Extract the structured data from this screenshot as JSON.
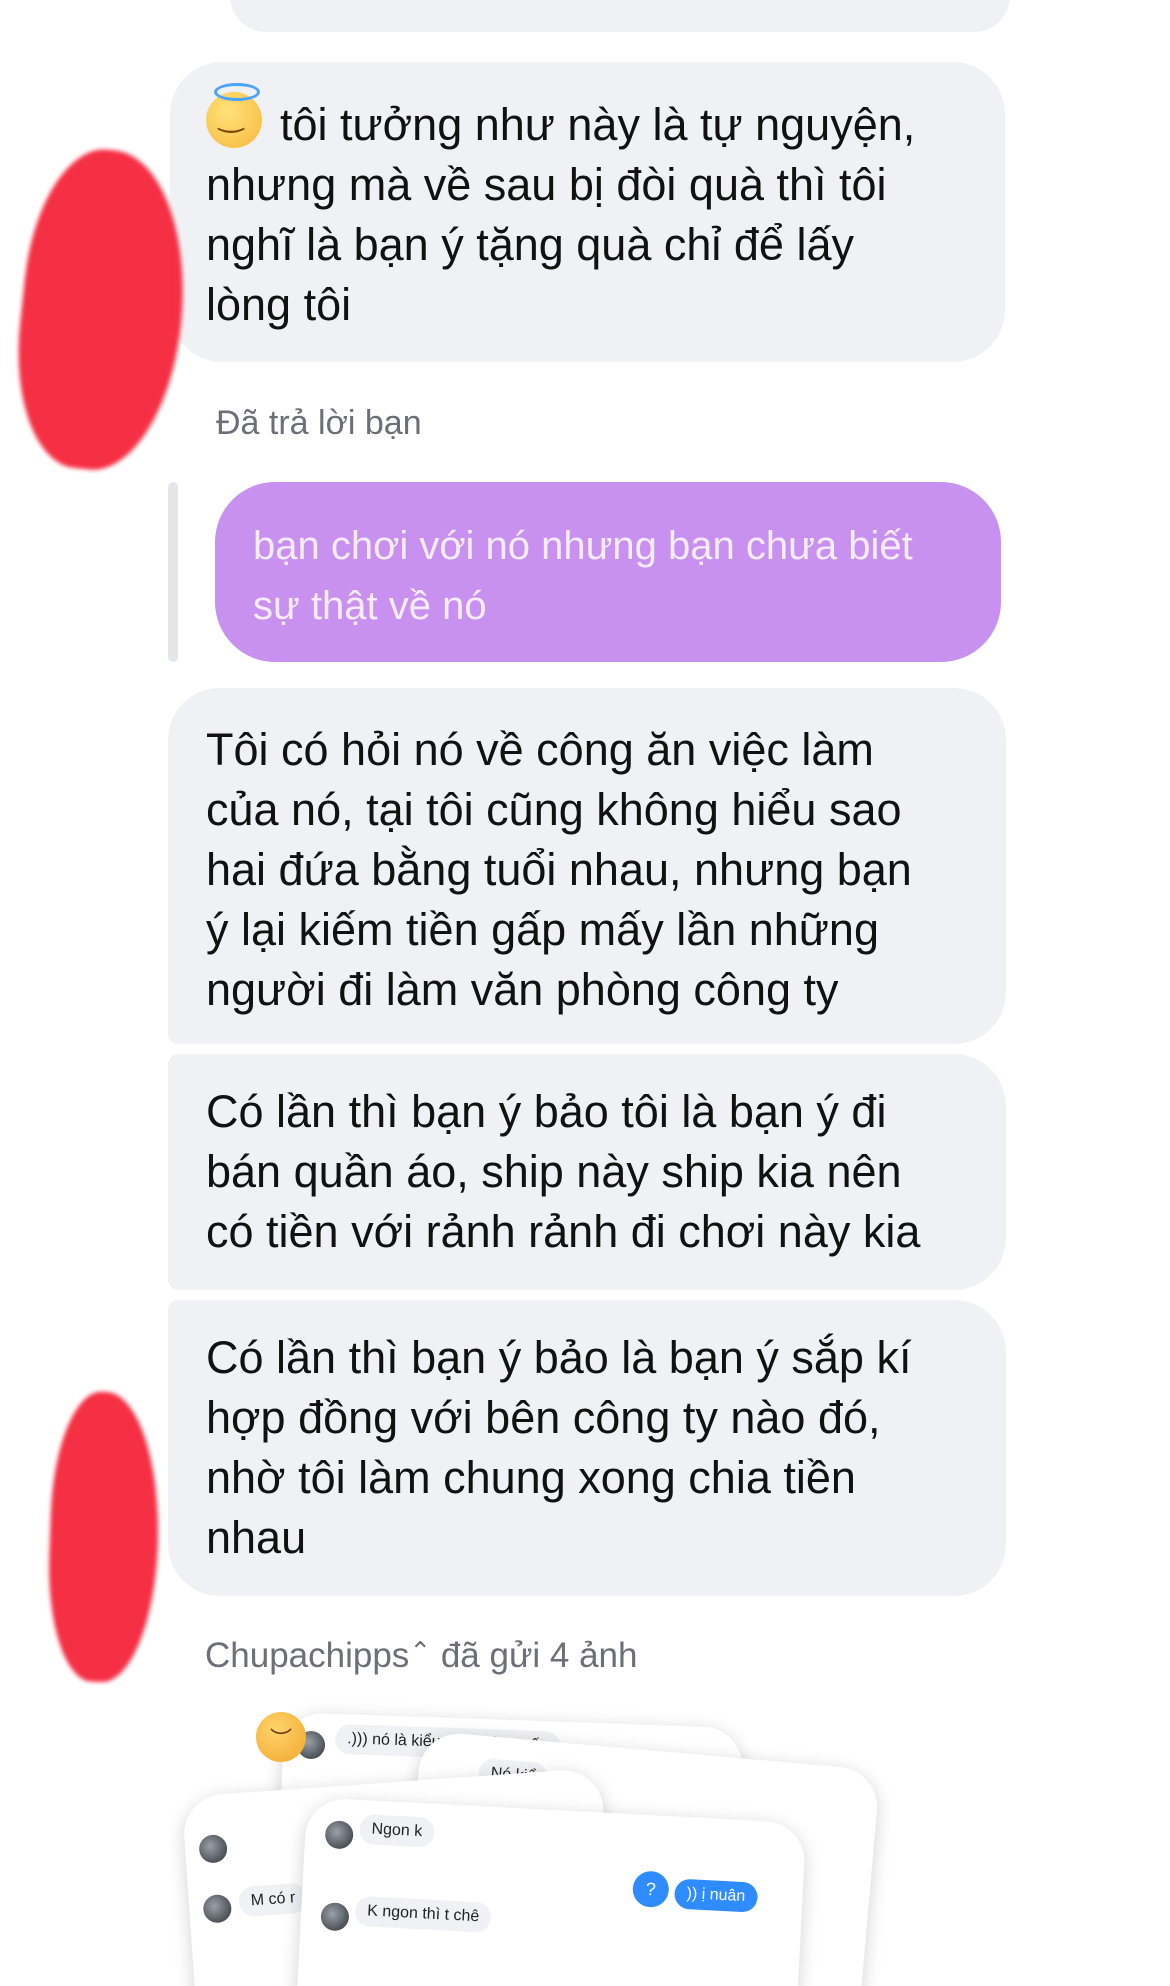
{
  "messages": {
    "m1": {
      "emoji_icon": "smiling-face-with-halo",
      "lines": [
        "tôi tưởng như này là tự nguyện,",
        "nhưng mà về sau bị đòi quà thì tôi",
        "nghĩ là bạn ý tặng quà chỉ để lấy",
        "lòng tôi"
      ]
    },
    "reply": {
      "label": "Đã trả lời bạn",
      "lines": [
        "bạn chơi với nó nhưng bạn chưa biết",
        "sự thật về nó"
      ],
      "bubble_color": "#c891ef"
    },
    "m2": {
      "lines": [
        "Tôi có hỏi nó về công ăn việc làm",
        "của nó, tại tôi cũng không hiểu sao",
        "hai đứa bằng tuổi nhau, nhưng bạn",
        "ý lại kiếm tiền gấp mấy lần những",
        "người đi làm văn phòng công ty"
      ]
    },
    "m3": {
      "lines": [
        "Có lần thì bạn ý bảo tôi là bạn ý đi",
        "bán quần áo, ship này ship kia nên",
        "có tiền với rảnh rảnh đi chơi này kia"
      ]
    },
    "m4": {
      "lines": [
        "Có lần thì bạn ý bảo là bạn ý sắp kí",
        "hợp đồng với bên công ty nào đó,",
        "nhờ tôi làm chung xong chia tiền",
        "nhau"
      ]
    }
  },
  "sent_photos": {
    "sender": "Chupachipps",
    "sender_badge_icon": "sparkle-icon",
    "text": "đã gửi 4 ảnh",
    "cards": {
      "c1_chip": ".))) nó là kiểu xoay vòng vốn",
      "c1_blue": ")))))",
      "c2_chip": "Nó kiể",
      "c3_chip": "M có r",
      "c4_chip1": "Ngon k",
      "c4_chip2": "K ngon thì t chê",
      "c4_blue": ")) ị nuân",
      "c4_dot": "?"
    }
  },
  "colors": {
    "incoming_bubble": "#eff1f4",
    "muted_text": "#6b6f76",
    "redaction": "#f5243a"
  }
}
